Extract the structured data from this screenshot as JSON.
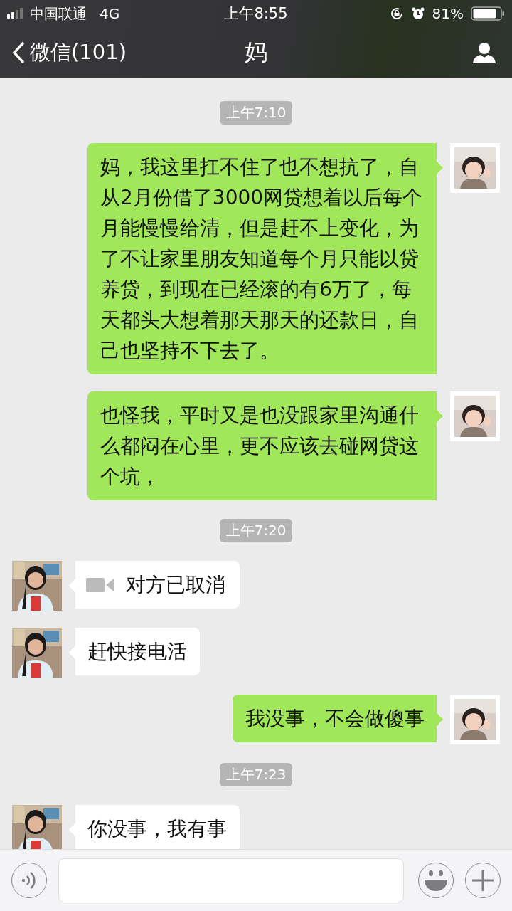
{
  "status_bar": {
    "carrier": "中国联通",
    "network": "4G",
    "time": "上午8:55",
    "battery": "81%"
  },
  "nav": {
    "back": "微信(101)",
    "title": "妈"
  },
  "messages": [
    {
      "kind": "time",
      "text": "上午7:10"
    },
    {
      "kind": "text",
      "outgoing": true,
      "text": "妈，我这里扛不住了也不想抗了，自从2月份借了3000网贷想着以后每个月能慢慢给清，但是赶不上变化，为了不让家里朋友知道每个月只能以贷养贷，到现在已经滚的有6万了，每天都头大想着那天那天的还款日，自己也坚持不下去了。"
    },
    {
      "kind": "text",
      "outgoing": true,
      "text": "也怪我，平时又是也没跟家里沟通什么都闷在心里，更不应该去碰网贷这个坑，"
    },
    {
      "kind": "time",
      "text": "上午7:20"
    },
    {
      "kind": "call",
      "outgoing": false,
      "text": "对方已取消"
    },
    {
      "kind": "text",
      "outgoing": false,
      "text": "赶快接电活"
    },
    {
      "kind": "text",
      "outgoing": true,
      "text": "我没事，不会做傻事"
    },
    {
      "kind": "time",
      "text": "上午7:23"
    },
    {
      "kind": "text",
      "outgoing": false,
      "text": "你没事，我有事"
    }
  ]
}
